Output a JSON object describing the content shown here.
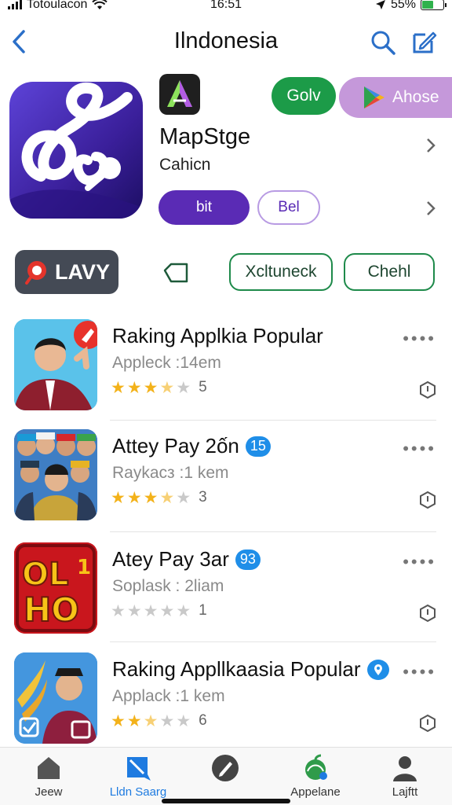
{
  "status": {
    "carrier": "Totoulacon",
    "time": "16:51",
    "battery": "55%",
    "battery_level": 0.55
  },
  "nav": {
    "title": "Ilndonesia"
  },
  "featured": {
    "app_name": "MapStge",
    "app_sub": "Cahicn",
    "btn_golv": "Golv",
    "btn_ahose": "Ahose",
    "btn_bit": "bit",
    "btn_bel": "Bel"
  },
  "chips": {
    "lavy": "LAVY",
    "xcltuneck": "Xcltuneck",
    "chehl": "Chehl"
  },
  "list": [
    {
      "name": "Raking Applkia Popular",
      "badge": "",
      "sub": "Appleck :14em",
      "stars": 3.5,
      "count": "5"
    },
    {
      "name": "Attey Pay 2ốn",
      "badge": "15",
      "sub": "Raykacз :1 kem",
      "stars": 3.5,
      "count": "3"
    },
    {
      "name": "Atey Pay 3ar",
      "badge": "93",
      "sub": "Soplask : 2liam",
      "stars": 0,
      "count": "1"
    },
    {
      "name": "Raking Appllkaasia Popular",
      "badge": "pin",
      "sub": "Applack :1 kem",
      "stars": 2.5,
      "count": "6"
    }
  ],
  "thumb3_text": {
    "top": "OL",
    "bottom": "HO",
    "num": "1"
  },
  "tabs": [
    {
      "label": "Jeew",
      "icon": "home-icon"
    },
    {
      "label": "Lldn Saarg",
      "icon": "store-icon"
    },
    {
      "label": "",
      "icon": "pen-icon"
    },
    {
      "label": "Appelane",
      "icon": "apple-icon"
    },
    {
      "label": "Lajftt",
      "icon": "person-icon"
    }
  ],
  "colors": {
    "accent_green": "#1c9b48",
    "accent_purple": "#5a2bb5",
    "star": "#f3b21a",
    "tab_active": "#1e7be0"
  }
}
